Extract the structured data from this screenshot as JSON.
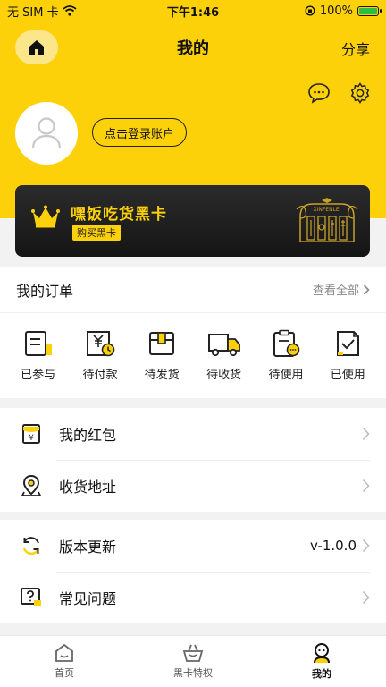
{
  "status_bar": {
    "carrier": "无 SIM 卡",
    "time": "下午1:46",
    "battery": "100%",
    "battery_level": 1.0
  },
  "header": {
    "title": "我的",
    "share_label": "分享",
    "login_label": "点击登录账户"
  },
  "black_card": {
    "title": "嘿饭吃货黑卡",
    "buy_label": "购买黑卡",
    "logo_text": "XINFENLEI"
  },
  "orders": {
    "title": "我的订单",
    "view_all": "查看全部",
    "items": [
      {
        "label": "已参与",
        "icon": "participated-icon"
      },
      {
        "label": "待付款",
        "icon": "pending-payment-icon"
      },
      {
        "label": "待发货",
        "icon": "pending-shipment-icon"
      },
      {
        "label": "待收货",
        "icon": "pending-receipt-icon"
      },
      {
        "label": "待使用",
        "icon": "to-use-icon"
      },
      {
        "label": "已使用",
        "icon": "used-icon"
      }
    ]
  },
  "menu1": [
    {
      "label": "我的红包",
      "icon": "red-packet-icon"
    },
    {
      "label": "收货地址",
      "icon": "location-icon"
    }
  ],
  "menu2": [
    {
      "label": "版本更新",
      "value": "v-1.0.0",
      "icon": "refresh-icon"
    },
    {
      "label": "常见问题",
      "icon": "faq-icon"
    }
  ],
  "tabbar": [
    {
      "label": "首页",
      "icon": "home-tab-icon"
    },
    {
      "label": "黑卡特权",
      "icon": "basket-icon"
    },
    {
      "label": "我的",
      "icon": "profile-tab-icon"
    }
  ],
  "colors": {
    "accent": "#fdd10a",
    "card_bg": "#1c1c1c"
  }
}
